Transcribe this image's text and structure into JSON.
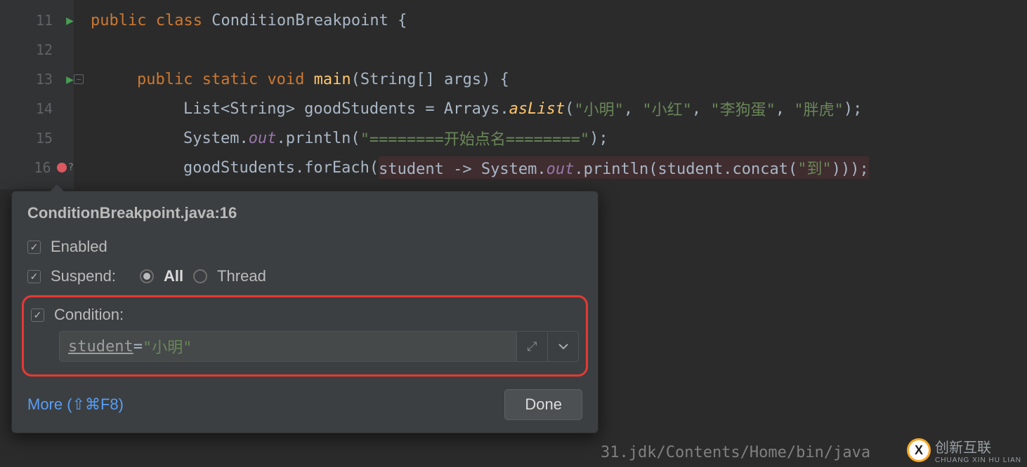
{
  "gutter": {
    "lines": [
      "11",
      "12",
      "13",
      "14",
      "15",
      "16"
    ]
  },
  "code": {
    "l11": {
      "kw1": "public ",
      "kw2": "class ",
      "cls": "ConditionBreakpoint ",
      "brace": "{"
    },
    "l13": {
      "kw1": "public ",
      "kw2": "static ",
      "kw3": "void ",
      "fn": "main",
      "sig": "(String[] args) {"
    },
    "l14": {
      "pre": "List<String> goodStudents = Arrays.",
      "mth": "asList",
      "open": "(",
      "s1": "\"小明\"",
      "c1": ", ",
      "s2": "\"小红\"",
      "c2": ", ",
      "s3": "\"李狗蛋\"",
      "c3": ", ",
      "s4": "\"胖虎\"",
      "close": ");"
    },
    "l15": {
      "pre": "System.",
      "out": "out",
      "mid": ".println(",
      "s": "\"========开始点名========\"",
      "close": ");"
    },
    "l16": {
      "pre": "goodStudents.forEach(",
      "lam": "student -> System.",
      "out": "out",
      "mid": ".println(student.concat(",
      "s": "\"到\"",
      "close": ")));"
    }
  },
  "popup": {
    "title": "ConditionBreakpoint.java:16",
    "enabled_label": "Enabled",
    "suspend_label": "Suspend:",
    "radio_all": "All",
    "radio_thread": "Thread",
    "condition_label": "Condition:",
    "condition_var": "student",
    "condition_op": " = ",
    "condition_val": "\"小明\"",
    "more_label": "More (⇧⌘F8)",
    "done_label": "Done"
  },
  "pathbar": "31.jdk/Contents/Home/bin/java",
  "watermark": {
    "main": "创新互联",
    "sub": "CHUANG XIN HU LIAN"
  }
}
